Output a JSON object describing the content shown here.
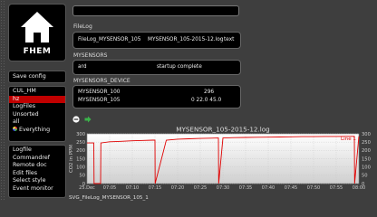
{
  "app": {
    "logo_text": "FHEM"
  },
  "topbar": {
    "command_value": ""
  },
  "menu": {
    "save_config": "Save config",
    "groups": [
      {
        "label": "CUL_HM"
      },
      {
        "label": "hz"
      },
      {
        "label": "LogFiles"
      },
      {
        "label": "Unsorted"
      },
      {
        "label": "all"
      },
      {
        "label": "Everything"
      }
    ],
    "tools": [
      {
        "label": "Logfile"
      },
      {
        "label": "Commandref"
      },
      {
        "label": "Remote doc"
      },
      {
        "label": "Edit files"
      },
      {
        "label": "Select style"
      },
      {
        "label": "Event monitor"
      }
    ]
  },
  "filelog": {
    "title": "FileLog",
    "name": "FileLog_MYSENSOR_105",
    "file": "MYSENSOR_105-2015-12.log",
    "action": "text"
  },
  "mysensors": {
    "title": "MYSENSORS",
    "name": "ard",
    "state": "startup complete"
  },
  "devices": {
    "title": "MYSENSORS_DEVICE",
    "rows": [
      {
        "name": "MYSENSOR_100",
        "value": "296"
      },
      {
        "name": "MYSENSOR_105",
        "value": "0 22.0 45.0"
      }
    ]
  },
  "chart_data": {
    "type": "line",
    "title": "MYSENSOR_105-2015-12.log",
    "ylabel": "CO2 in PPM",
    "x_ticks": [
      "25.Dec",
      "07:05",
      "07:10",
      "07:15",
      "07:20",
      "07:25",
      "07:30",
      "07:35",
      "07:40",
      "07:45",
      "07:50",
      "07:55",
      "08:00"
    ],
    "y_ticks": [
      "0",
      "50",
      "100",
      "150",
      "200",
      "250",
      "300"
    ],
    "y2_ticks": [
      "0",
      "50",
      "100",
      "150",
      "200",
      "250",
      "300"
    ],
    "ylim": [
      0,
      300
    ],
    "legend": "Line 1",
    "legend_position": "top-right",
    "grid": true,
    "footer": "SVG_FileLog_MYSENSOR_105_1",
    "series": [
      {
        "color": "#e00000",
        "x": [
          0,
          0.3,
          0.31,
          0.6,
          0.61,
          1,
          1.5,
          2,
          2.5,
          2.9,
          3.0,
          3.01,
          3.5,
          4,
          4.5,
          5,
          5.5,
          5.8,
          5.81,
          6,
          6.5,
          7,
          7.5,
          8,
          8.5,
          9,
          9.5,
          10,
          10.5,
          11,
          11.5,
          11.8,
          11.81,
          12
        ],
        "y": [
          245,
          245,
          0,
          0,
          245,
          252,
          255,
          258,
          260,
          262,
          262,
          0,
          262,
          268,
          270,
          272,
          274,
          275,
          0,
          275,
          277,
          278,
          279,
          280,
          281,
          282,
          283,
          283,
          284,
          284,
          285,
          285,
          0,
          285
        ]
      }
    ]
  }
}
